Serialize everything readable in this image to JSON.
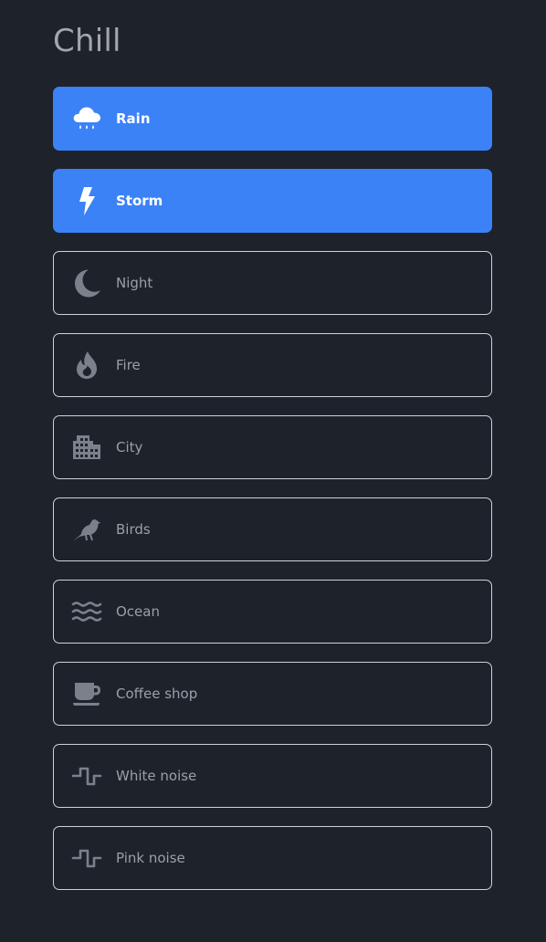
{
  "page": {
    "title": "Chill"
  },
  "colors": {
    "background": "#1e222b",
    "active": "#3b82f6",
    "border": "#cfd3d8",
    "icon_inactive": "#7b818a",
    "label_inactive": "#9aa0a8"
  },
  "sounds": [
    {
      "label": "Rain",
      "icon": "cloud-rain-icon",
      "active": true
    },
    {
      "label": "Storm",
      "icon": "lightning-bolt-icon",
      "active": true
    },
    {
      "label": "Night",
      "icon": "moon-icon",
      "active": false
    },
    {
      "label": "Fire",
      "icon": "fire-icon",
      "active": false
    },
    {
      "label": "City",
      "icon": "city-icon",
      "active": false
    },
    {
      "label": "Birds",
      "icon": "bird-icon",
      "active": false
    },
    {
      "label": "Ocean",
      "icon": "waves-icon",
      "active": false
    },
    {
      "label": "Coffee shop",
      "icon": "coffee-cup-icon",
      "active": false
    },
    {
      "label": "White noise",
      "icon": "square-wave-icon",
      "active": false
    },
    {
      "label": "Pink noise",
      "icon": "square-wave-icon",
      "active": false
    }
  ]
}
